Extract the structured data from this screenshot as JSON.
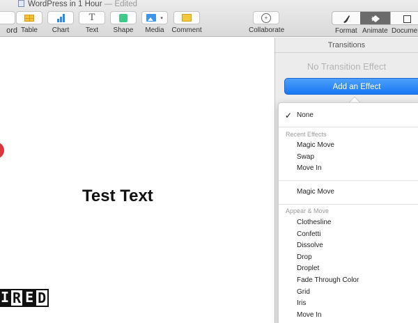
{
  "window": {
    "title": "WordPress in 1 Hour",
    "edited_label": "— Edited"
  },
  "toolbar": {
    "partial_left_label": "ord",
    "table_label": "Table",
    "chart_label": "Chart",
    "text_label": "Text",
    "text_icon_glyph": "T",
    "shape_label": "Shape",
    "media_label": "Media",
    "comment_label": "Comment",
    "collaborate_label": "Collaborate",
    "format_label": "Format",
    "animate_label": "Animate",
    "document_label": "Documen"
  },
  "canvas": {
    "slide_text": "Test Text",
    "logo_letters": [
      "R",
      "E",
      "D"
    ],
    "logo_partial": "I"
  },
  "inspector": {
    "title": "Transitions",
    "no_effect": "No Transition Effect",
    "add_effect_button": "Add an Effect"
  },
  "menu": {
    "check_glyph": "✓",
    "selected": "None",
    "recent_header": "Recent Effects",
    "recent": [
      "Magic Move",
      "Swap",
      "Move In"
    ],
    "magic_move": "Magic Move",
    "appear_header": "Appear & Move",
    "appear": [
      "Clothesline",
      "Confetti",
      "Dissolve",
      "Drop",
      "Droplet",
      "Fade Through Color",
      "Grid",
      "Iris",
      "Move In"
    ]
  },
  "colors": {
    "accent": "#1878f3",
    "logo_red": "#d9363e"
  }
}
